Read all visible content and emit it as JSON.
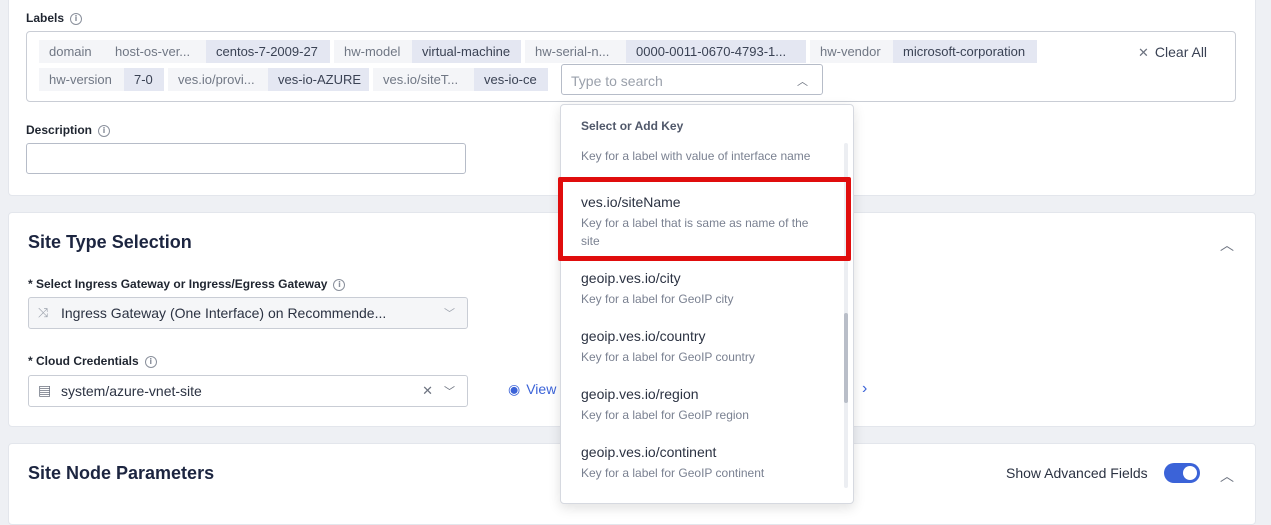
{
  "labels_section": {
    "label": "Labels",
    "chips": [
      {
        "text": "domain",
        "kind": "key"
      },
      {
        "text": "host-os-ver...",
        "kind": "key"
      },
      {
        "text": "centos-7-2009-27",
        "kind": "value"
      },
      {
        "text": "hw-model",
        "kind": "key"
      },
      {
        "text": "virtual-machine",
        "kind": "value"
      },
      {
        "text": "hw-serial-n...",
        "kind": "key"
      },
      {
        "text": "0000-0011-0670-4793-1...",
        "kind": "value"
      },
      {
        "text": "hw-vendor",
        "kind": "key"
      },
      {
        "text": "microsoft-corporation",
        "kind": "value"
      },
      {
        "text": "hw-version",
        "kind": "key"
      },
      {
        "text": "7-0",
        "kind": "value"
      },
      {
        "text": "ves.io/provi...",
        "kind": "key"
      },
      {
        "text": "ves-io-AZURE",
        "kind": "value"
      },
      {
        "text": "ves.io/siteT...",
        "kind": "key"
      },
      {
        "text": "ves-io-ce",
        "kind": "value"
      }
    ],
    "clear_all": "Clear All",
    "search_placeholder": "Type to search"
  },
  "description": {
    "label": "Description",
    "value": ""
  },
  "site_type": {
    "title": "Site Type Selection",
    "gateway_label": "* Select Ingress Gateway or Ingress/Egress Gateway",
    "gateway_value": "Ingress Gateway (One Interface) on Recommende...",
    "credentials_label": "* Cloud Credentials",
    "credentials_value": "system/azure-vnet-site",
    "view_link": "View"
  },
  "site_node": {
    "title": "Site Node Parameters",
    "advanced_label": "Show Advanced Fields",
    "advanced_on": true
  },
  "dropdown": {
    "header": "Select or Add Key",
    "options": [
      {
        "title": "",
        "desc": "Key for a label with value of interface name"
      },
      {
        "title": "ves.io/siteName",
        "desc": "Key for a label that is same as name of the site"
      },
      {
        "title": "geoip.ves.io/city",
        "desc": "Key for a label for GeoIP city"
      },
      {
        "title": "geoip.ves.io/country",
        "desc": "Key for a label for GeoIP country"
      },
      {
        "title": "geoip.ves.io/region",
        "desc": "Key for a label for GeoIP region"
      },
      {
        "title": "geoip.ves.io/continent",
        "desc": "Key for a label for GeoIP continent"
      }
    ]
  },
  "colors": {
    "accent": "#3b63d8",
    "highlight": "#e00d0d",
    "title": "#1c2540"
  }
}
